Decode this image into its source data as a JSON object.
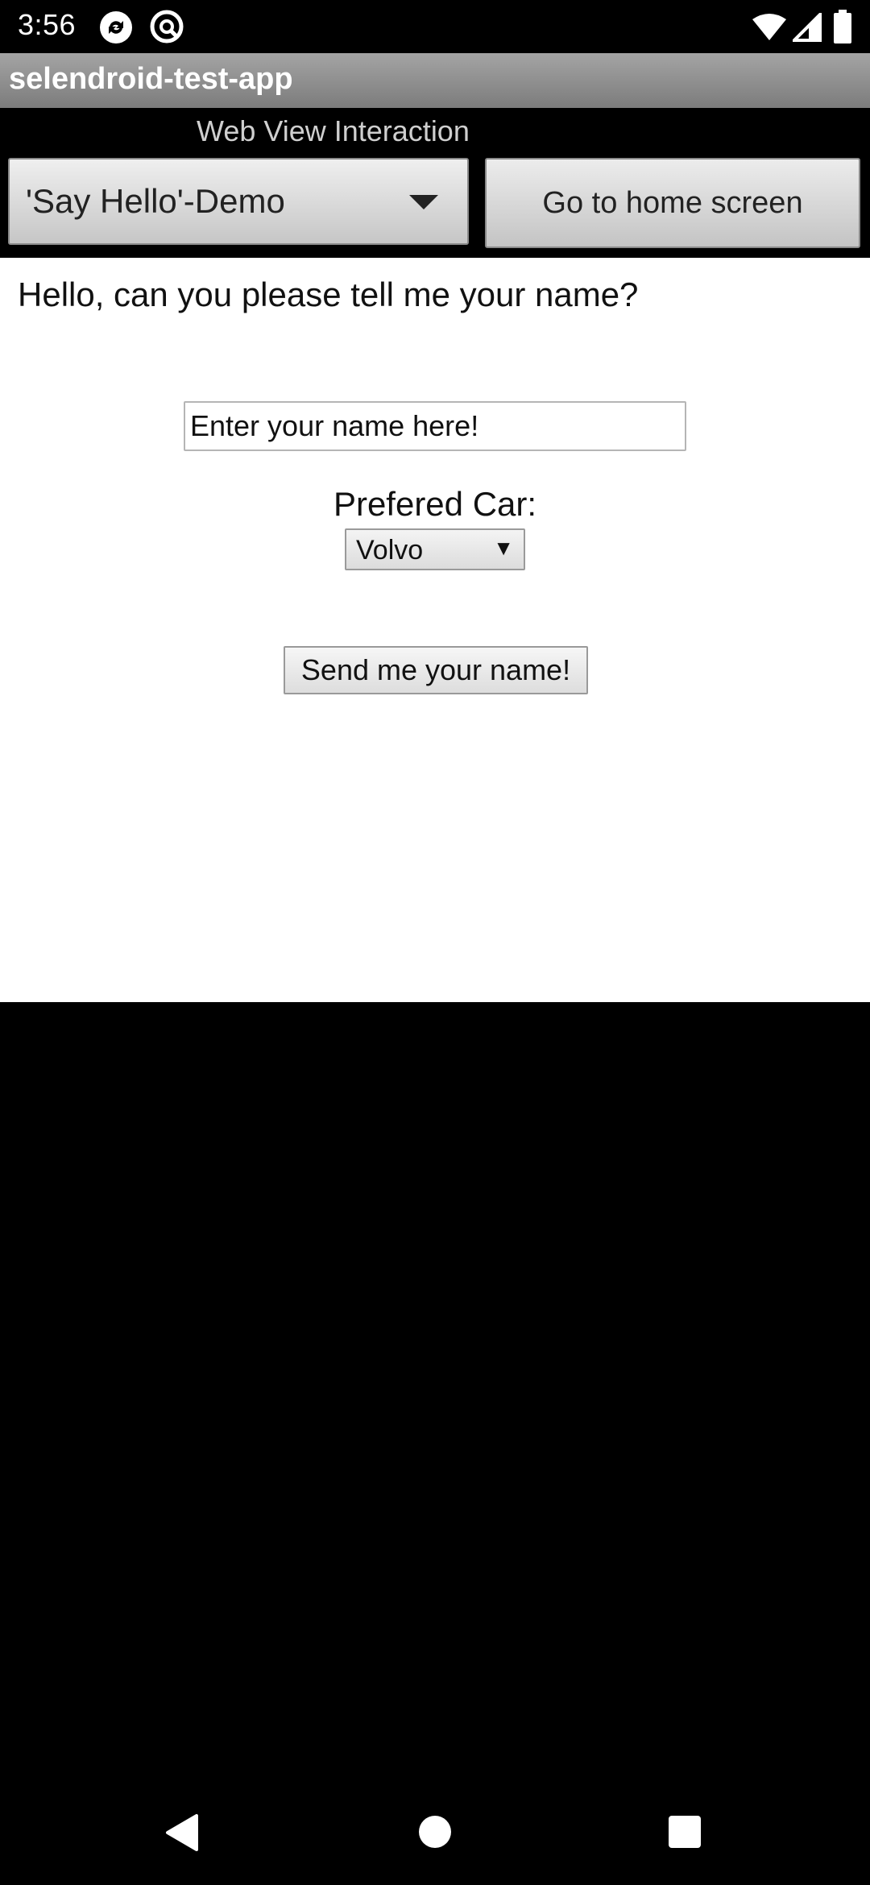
{
  "status_bar": {
    "time": "3:56",
    "icons": [
      "sync-notification-icon",
      "at-notification-icon",
      "wifi-icon",
      "cell-signal-icon",
      "battery-icon"
    ]
  },
  "app": {
    "title": "selendroid-test-app"
  },
  "header": {
    "activity_label": "Web View Interaction",
    "spinner_value": "'Say Hello'-Demo",
    "home_button_label": "Go to home screen"
  },
  "webview": {
    "question": "Hello, can you please tell me your name?",
    "name_placeholder": "Enter your name here!",
    "car_label": "Prefered Car:",
    "car_selected": "Volvo",
    "send_label": "Send me your name!"
  },
  "nav_bar": {
    "icons": [
      "back-icon",
      "home-icon",
      "recents-icon"
    ]
  },
  "colors": {
    "background": "#000000",
    "title_bar": "#8f8f8f",
    "webview_background": "#ffffff"
  }
}
